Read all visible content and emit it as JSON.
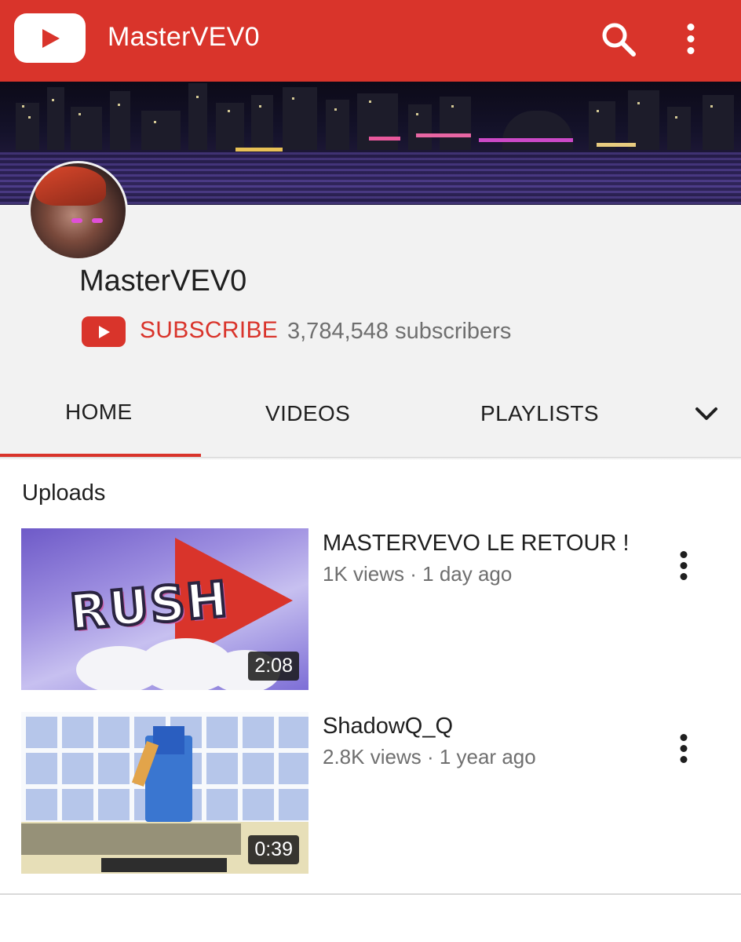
{
  "app_bar": {
    "title": "MasterVEV0",
    "logo_icon": "youtube-logo-icon",
    "search_icon": "search-icon",
    "more_icon": "more-vert-icon",
    "background_color": "#d9342b"
  },
  "channel": {
    "name": "MasterVEV0",
    "subscribe_label": "SUBSCRIBE",
    "subscriber_count": "3,784,548 subscribers",
    "subscribe_color": "#d9342b"
  },
  "tabs": {
    "items": [
      {
        "label": "HOME",
        "selected": true
      },
      {
        "label": "VIDEOS",
        "selected": false
      },
      {
        "label": "PLAYLISTS",
        "selected": false
      }
    ],
    "overflow_icon": "chevron-down-icon"
  },
  "uploads": {
    "title": "Uploads",
    "videos": [
      {
        "title": "MASTERVEVO LE RETOUR !",
        "meta": "1K views · 1 day ago",
        "duration": "2:08",
        "thumbnail_text": "RUSH"
      },
      {
        "title": "ShadowQ_Q",
        "meta": "2.8K views · 1 year ago",
        "duration": "0:39"
      }
    ]
  }
}
